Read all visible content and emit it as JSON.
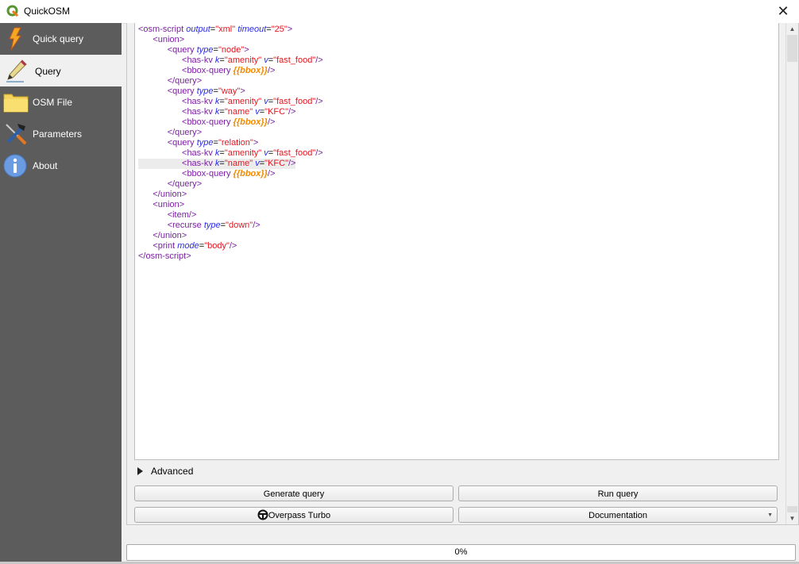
{
  "window": {
    "title": "QuickOSM",
    "close_icon": "close-icon"
  },
  "sidebar": {
    "items": [
      {
        "label": "Quick query",
        "icon": "lightning-icon",
        "active": false
      },
      {
        "label": "Query",
        "icon": "pencil-icon",
        "active": true
      },
      {
        "label": "OSM File",
        "icon": "folder-icon",
        "active": false
      },
      {
        "label": "Parameters",
        "icon": "tools-icon",
        "active": false
      },
      {
        "label": "About",
        "icon": "info-icon",
        "active": false
      }
    ]
  },
  "editor": {
    "lines": [
      "<osm-script output=\"xml\" timeout=\"25\">",
      "  <union>",
      "    <query type=\"node\">",
      "      <has-kv k=\"amenity\" v=\"fast_food\"/>",
      "      <bbox-query {{bbox}}/>",
      "    </query>",
      "    <query type=\"way\">",
      "      <has-kv k=\"amenity\" v=\"fast_food\"/>",
      "      <has-kv k=\"name\" v=\"KFC\"/>",
      "      <bbox-query {{bbox}}/>",
      "    </query>",
      "    <query type=\"relation\">",
      "      <has-kv k=\"amenity\" v=\"fast_food\"/>",
      "      <has-kv k=\"name\" v=\"KFC\"/>",
      "      <bbox-query {{bbox}}/>",
      "    </query>",
      "  </union>",
      "  <union>",
      "    <item/>",
      "    <recurse type=\"down\"/>",
      "  </union>",
      "  <print mode=\"body\"/>",
      "</osm-script>"
    ],
    "highlighted_line": 13
  },
  "advanced": {
    "label": "Advanced"
  },
  "buttons": {
    "generate_query": "Generate query",
    "run_query": "Run query",
    "overpass_turbo": "Overpass Turbo",
    "documentation": "Documentation"
  },
  "progress": {
    "value": 0,
    "label": "0%"
  },
  "colors": {
    "sidebar_bg": "#5c5c5c",
    "tag": "#7a1fa2",
    "attr": "#2a2ae8",
    "string": "#e8141e",
    "template": "#f08a00"
  }
}
